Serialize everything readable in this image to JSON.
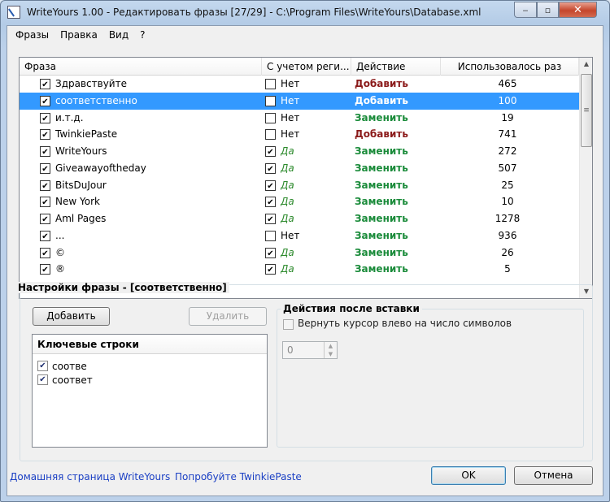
{
  "window": {
    "title": "WriteYours 1.00 - Редактировать фразы [27/29] - C:\\Program Files\\WriteYours\\Database.xml",
    "minimize": "‒",
    "maximize": "▫",
    "close": "✕"
  },
  "menu": [
    "Фразы",
    "Правка",
    "Вид",
    "?"
  ],
  "table": {
    "columns": [
      "Фраза",
      "С учетом реги...",
      "Действие",
      "Использовалось раз"
    ],
    "rows": [
      {
        "checked": true,
        "phrase": "Здравствуйте",
        "case_checked": false,
        "case": "Нет",
        "action": "Добавить",
        "action_type": "add",
        "count": "465"
      },
      {
        "checked": true,
        "phrase": "соответственно",
        "case_checked": false,
        "case": "Нет",
        "action": "Добавить",
        "action_type": "add",
        "count": "100",
        "selected": true
      },
      {
        "checked": true,
        "phrase": "и.т.д.",
        "case_checked": false,
        "case": "Нет",
        "action": "Заменить",
        "action_type": "replace",
        "count": "19"
      },
      {
        "checked": true,
        "phrase": "TwinkiePaste",
        "case_checked": false,
        "case": "Нет",
        "action": "Добавить",
        "action_type": "add",
        "count": "741"
      },
      {
        "checked": true,
        "phrase": "WriteYours",
        "case_checked": true,
        "case": "Да",
        "action": "Заменить",
        "action_type": "replace",
        "count": "272"
      },
      {
        "checked": true,
        "phrase": "Giveawayoftheday",
        "case_checked": true,
        "case": "Да",
        "action": "Заменить",
        "action_type": "replace",
        "count": "507"
      },
      {
        "checked": true,
        "phrase": "BitsDuJour",
        "case_checked": true,
        "case": "Да",
        "action": "Заменить",
        "action_type": "replace",
        "count": "25"
      },
      {
        "checked": true,
        "phrase": "New York",
        "case_checked": true,
        "case": "Да",
        "action": "Заменить",
        "action_type": "replace",
        "count": "10"
      },
      {
        "checked": true,
        "phrase": "Aml Pages",
        "case_checked": true,
        "case": "Да",
        "action": "Заменить",
        "action_type": "replace",
        "count": "1278"
      },
      {
        "checked": true,
        "phrase": "...",
        "case_checked": false,
        "case": "Нет",
        "action": "Заменить",
        "action_type": "replace",
        "count": "936"
      },
      {
        "checked": true,
        "phrase": "©",
        "case_checked": true,
        "case": "Да",
        "action": "Заменить",
        "action_type": "replace",
        "count": "26"
      },
      {
        "checked": true,
        "phrase": "®",
        "case_checked": true,
        "case": "Да",
        "action": "Заменить",
        "action_type": "replace",
        "count": "5"
      }
    ]
  },
  "settings": {
    "title": "Настройки фразы - [соответственно]",
    "add_button": "Добавить",
    "delete_button": "Удалить",
    "keys_header": "Ключевые строки",
    "keys": [
      {
        "checked": true,
        "text": "соотве"
      },
      {
        "checked": true,
        "text": "соответ"
      }
    ],
    "after_title": "Действия после вставки",
    "cursor_label": "Вернуть курсор влево на число символов",
    "cursor_value": "0"
  },
  "footer": {
    "home_link": "Домашняя страница WriteYours",
    "try_link": "Попробуйте TwinkiePaste",
    "ok": "OK",
    "cancel": "Отмена"
  }
}
